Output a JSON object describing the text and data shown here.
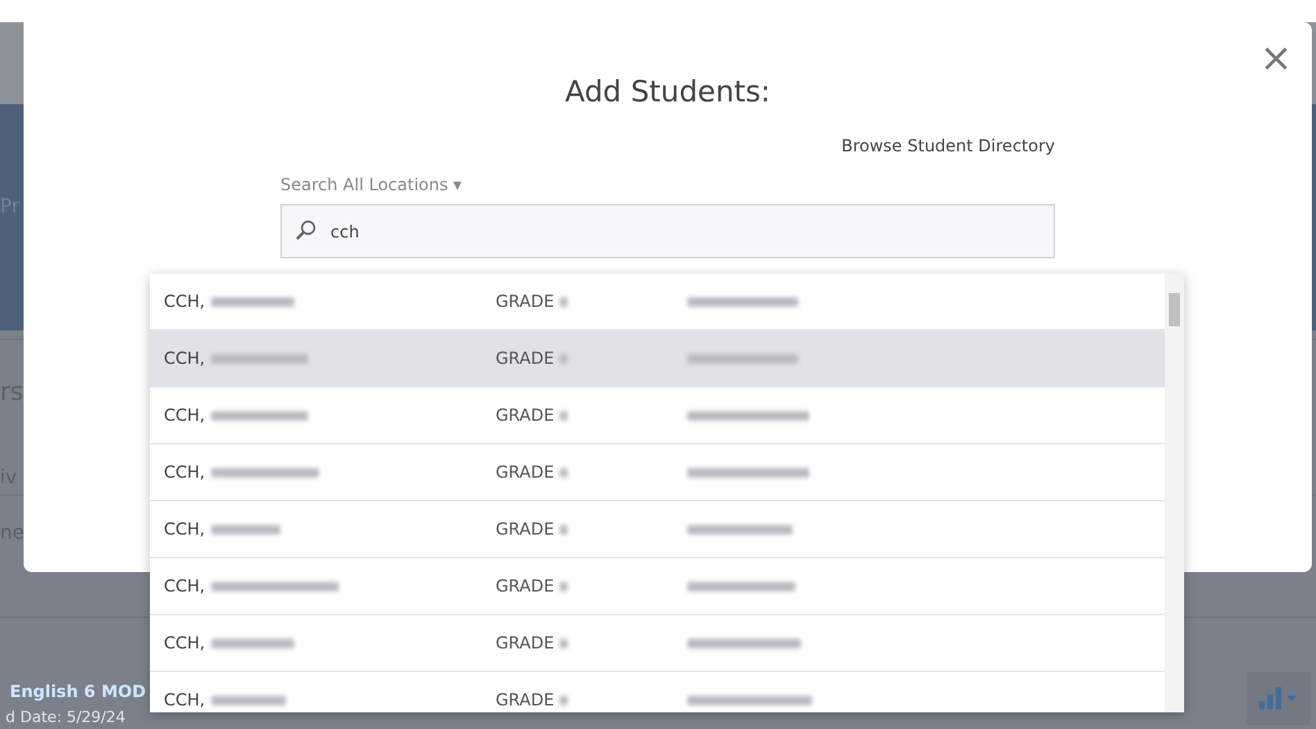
{
  "background_page": {
    "fragments": [
      "Pr",
      "rs",
      "iv",
      "ne"
    ],
    "course_title": "English 6 MOD",
    "course_date": "d Date: 5/29/24"
  },
  "dialog": {
    "title": "Add Students:",
    "browse_link": "Browse Student Directory",
    "location_filter": "Search All Locations",
    "caret": "▾",
    "search": {
      "value": "cch"
    },
    "close": "×",
    "results": [
      {
        "name": "CCH,",
        "grade": "GRADE",
        "selected": false
      },
      {
        "name": "CCH,",
        "grade": "GRADE",
        "selected": true
      },
      {
        "name": "CCH,",
        "grade": "GRADE",
        "selected": false
      },
      {
        "name": "CCH,",
        "grade": "GRADE",
        "selected": false
      },
      {
        "name": "CCH,",
        "grade": "GRADE",
        "selected": false
      },
      {
        "name": "CCH,",
        "grade": "GRADE",
        "selected": false
      },
      {
        "name": "CCH,",
        "grade": "GRADE",
        "selected": false
      },
      {
        "name": "CCH,",
        "grade": "GRADE",
        "selected": false
      }
    ]
  }
}
